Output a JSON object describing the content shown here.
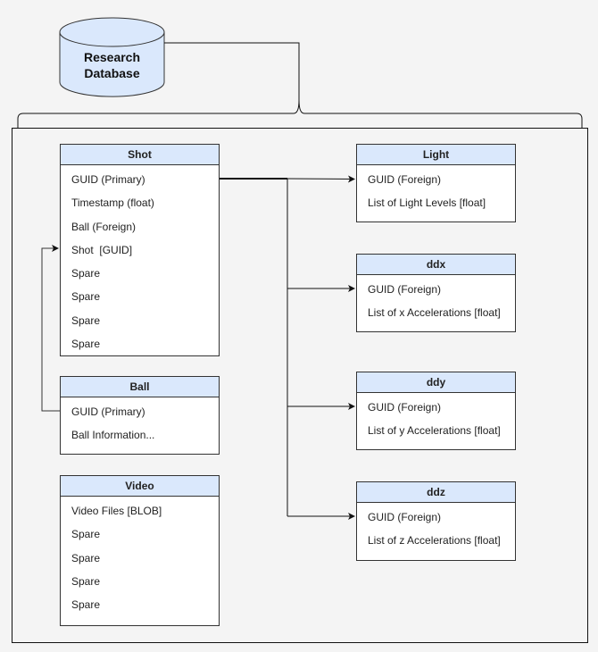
{
  "database": {
    "label_line1": "Research",
    "label_line2": "Database",
    "fill": "#dae8fc"
  },
  "header_fill": "#dae8fc",
  "tables": {
    "shot": {
      "title": "Shot",
      "rows": [
        "GUID (Primary)",
        "Timestamp (float)",
        "Ball (Foreign)",
        "Shot  [GUID]",
        "Spare",
        "Spare",
        "Spare",
        "Spare"
      ]
    },
    "ball": {
      "title": "Ball",
      "rows": [
        "GUID (Primary)",
        "Ball Information..."
      ]
    },
    "video": {
      "title": "Video",
      "rows": [
        "Video Files [BLOB]",
        "Spare",
        "Spare",
        "Spare",
        "Spare"
      ]
    },
    "light": {
      "title": "Light",
      "rows": [
        "GUID (Foreign)",
        "List of Light Levels [float]"
      ]
    },
    "ddx": {
      "title": "ddx",
      "rows": [
        "GUID (Foreign)",
        "List of x Accelerations [float]"
      ]
    },
    "ddy": {
      "title": "ddy",
      "rows": [
        "GUID (Foreign)",
        "List of y Accelerations [float]"
      ]
    },
    "ddz": {
      "title": "ddz",
      "rows": [
        "GUID (Foreign)",
        "List of z Accelerations [float]"
      ]
    }
  }
}
